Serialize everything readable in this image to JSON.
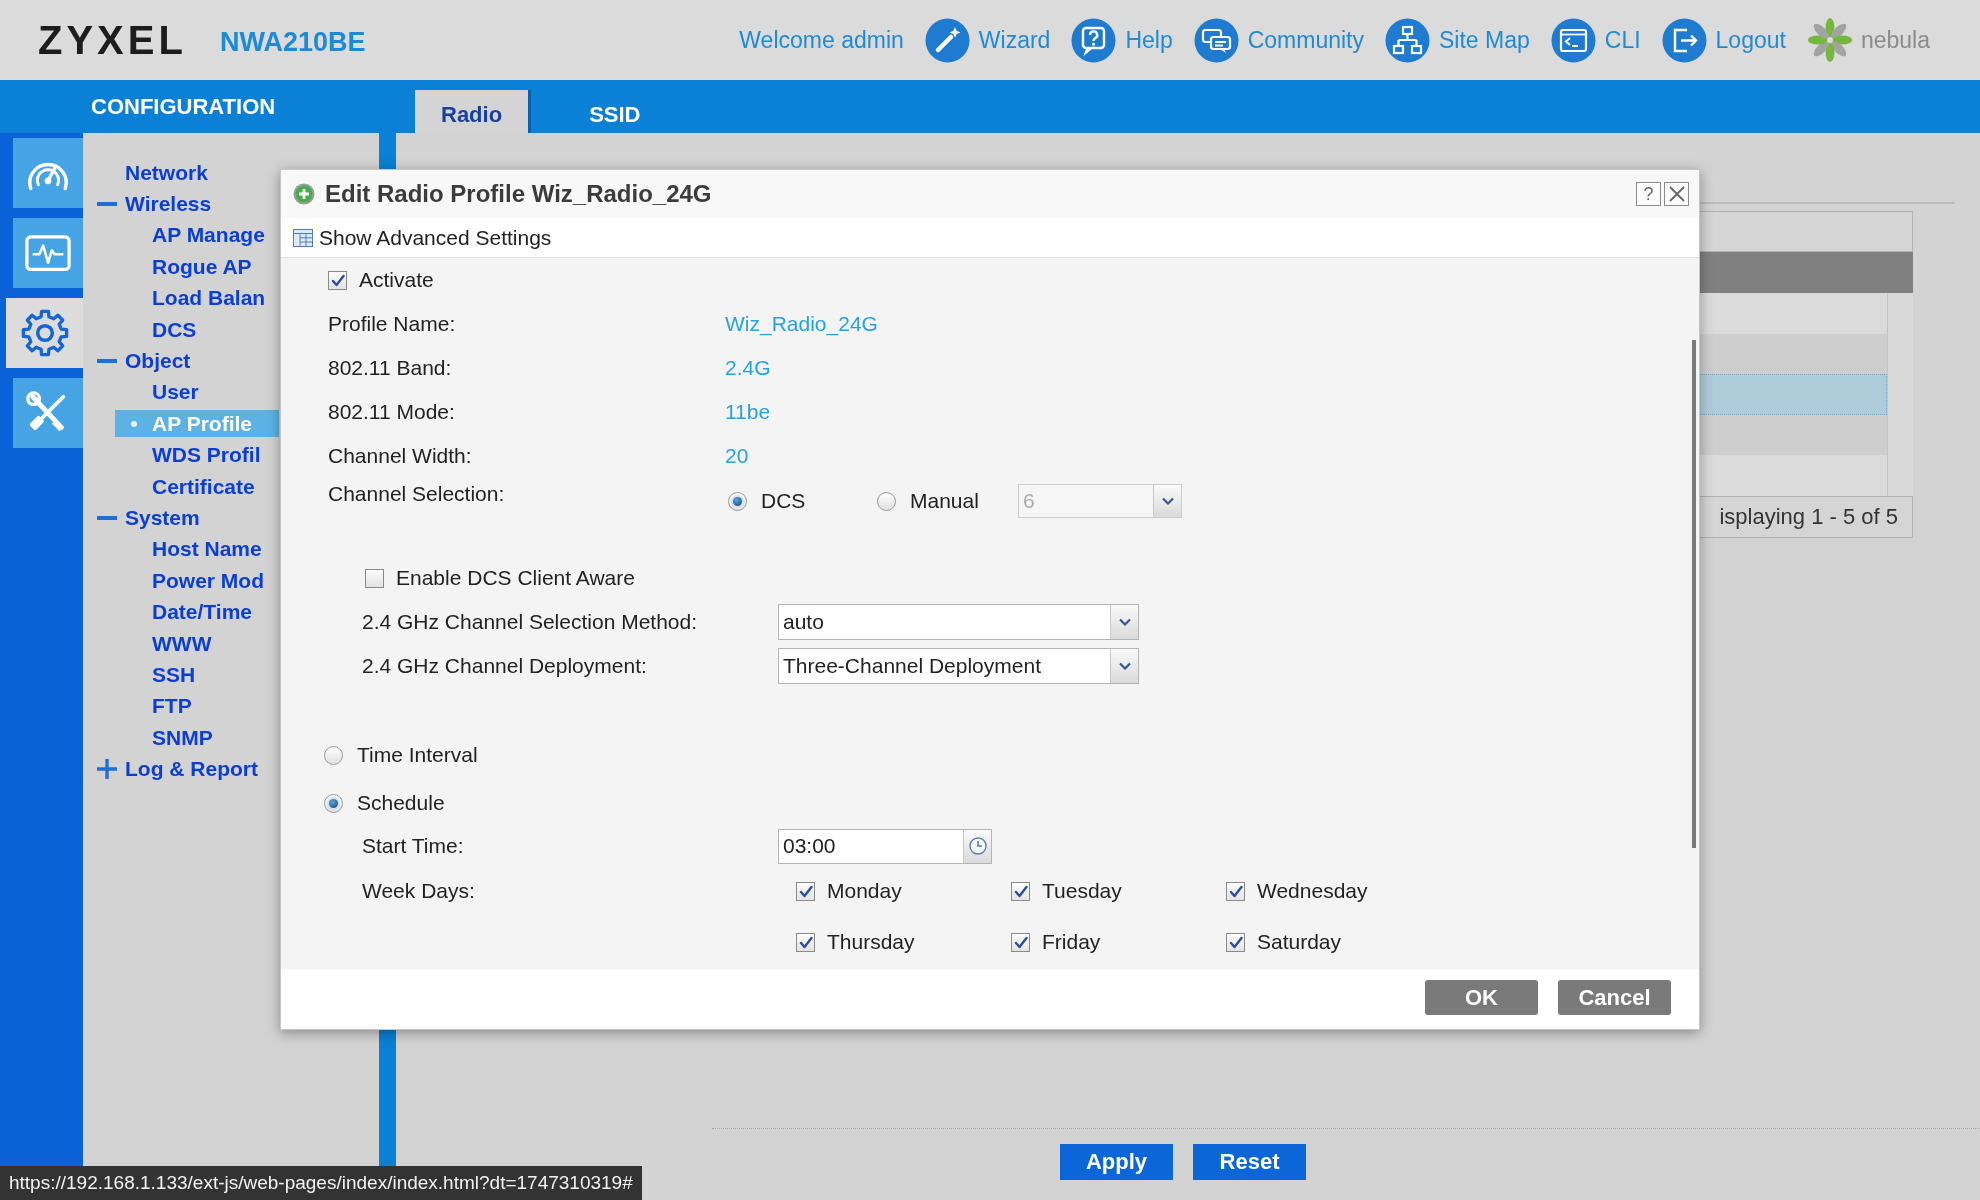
{
  "header": {
    "brand": "ZYXEL",
    "model": "NWA210BE",
    "welcome": "Welcome admin",
    "links": [
      "Wizard",
      "Help",
      "Community",
      "Site Map",
      "CLI",
      "Logout"
    ],
    "nebula": "nebula"
  },
  "section_title": "CONFIGURATION",
  "tabs": [
    {
      "label": "Radio",
      "selected": true
    },
    {
      "label": "SSID",
      "selected": false
    }
  ],
  "icon_rail": [
    {
      "selected": false
    },
    {
      "selected": false
    },
    {
      "selected": true
    },
    {
      "selected": false
    }
  ],
  "sidebar_tree": [
    {
      "label": "Network",
      "selected": false
    },
    {
      "label": "Wireless",
      "selected": false,
      "expanded": true,
      "children": [
        {
          "label": "AP Manage",
          "selected": false
        },
        {
          "label": "Rogue AP",
          "selected": false
        },
        {
          "label": "Load Balan",
          "selected": false
        },
        {
          "label": "DCS",
          "selected": false
        }
      ]
    },
    {
      "label": "Object",
      "selected": false,
      "expanded": true,
      "children": [
        {
          "label": "User",
          "selected": false
        },
        {
          "label": "AP Profile",
          "selected": true
        },
        {
          "label": "WDS Profil",
          "selected": false
        },
        {
          "label": "Certificate",
          "selected": false
        }
      ]
    },
    {
      "label": "System",
      "selected": false,
      "expanded": true,
      "children": [
        {
          "label": "Host Name",
          "selected": false
        },
        {
          "label": "Power Mod",
          "selected": false
        },
        {
          "label": "Date/Time",
          "selected": false
        },
        {
          "label": "WWW",
          "selected": false
        },
        {
          "label": "SSH",
          "selected": false
        },
        {
          "label": "FTP",
          "selected": false
        },
        {
          "label": "SNMP",
          "selected": false
        }
      ]
    },
    {
      "label": "Log & Report",
      "selected": false,
      "expanded": false
    }
  ],
  "profile_table": {
    "rows": [
      {
        "selected": false
      },
      {
        "selected": false
      },
      {
        "selected": true
      },
      {
        "selected": false
      },
      {
        "selected": false
      }
    ],
    "pager": "isplaying 1 - 5 of 5"
  },
  "dialog": {
    "title": "Edit Radio Profile Wiz_Radio_24G",
    "help_button": "?",
    "advanced_link": "Show Advanced Settings",
    "activate": {
      "label": "Activate",
      "checked": true
    },
    "info": [
      {
        "label": "Profile Name:",
        "value": "Wiz_Radio_24G"
      },
      {
        "label": "802.11 Band:",
        "value": "2.4G"
      },
      {
        "label": "802.11 Mode:",
        "value": "11be"
      },
      {
        "label": "Channel Width:",
        "value": "20"
      }
    ],
    "channel_selection": {
      "label": "Channel Selection:",
      "options": [
        {
          "label": "DCS",
          "selected": true
        },
        {
          "label": "Manual",
          "selected": false
        }
      ],
      "channel": {
        "value": "6",
        "disabled": true
      }
    },
    "dcs_client_aware": {
      "label": "Enable DCS Client Aware",
      "checked": false
    },
    "selects": [
      {
        "label": "2.4 GHz Channel Selection Method:",
        "value": "auto"
      },
      {
        "label": "2.4 GHz Channel Deployment:",
        "value": "Three-Channel Deployment"
      }
    ],
    "timing": [
      {
        "label": "Time Interval",
        "selected": false
      },
      {
        "label": "Schedule",
        "selected": true
      }
    ],
    "start_time": {
      "label": "Start Time:",
      "value": "03:00"
    },
    "week_days": {
      "label": "Week Days:",
      "days": [
        {
          "label": "Monday",
          "checked": true
        },
        {
          "label": "Tuesday",
          "checked": true
        },
        {
          "label": "Wednesday",
          "checked": true
        },
        {
          "label": "Thursday",
          "checked": true
        },
        {
          "label": "Friday",
          "checked": true
        },
        {
          "label": "Saturday",
          "checked": true
        }
      ]
    },
    "buttons": [
      "OK",
      "Cancel"
    ]
  },
  "page_buttons": [
    "Apply",
    "Reset"
  ],
  "status_url": "https://192.168.1.133/ext-js/web-pages/index/index.html?dt=1747310319#"
}
